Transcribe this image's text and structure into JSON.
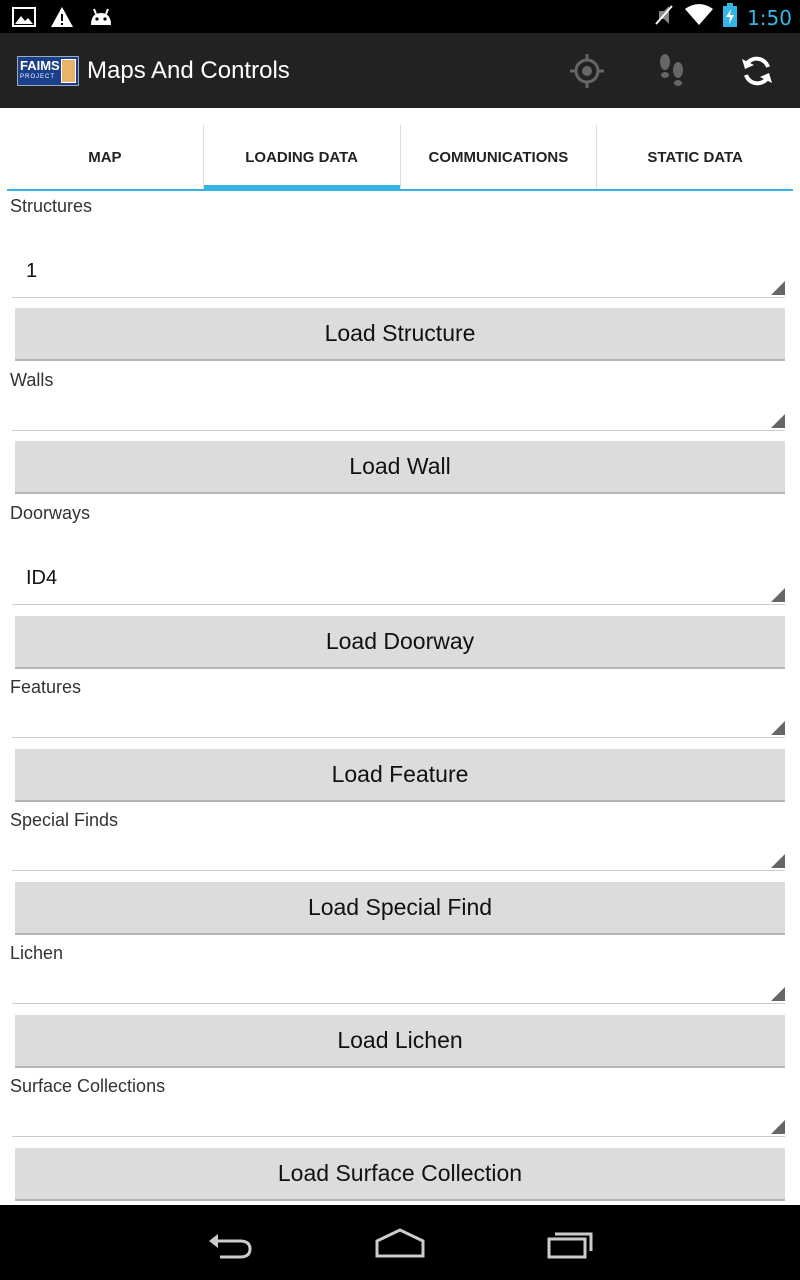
{
  "status_bar": {
    "time": "1:50",
    "left_icons": [
      "gallery-icon",
      "warning-icon",
      "android-icon"
    ],
    "right_icons": [
      "mute-icon",
      "wifi-icon",
      "battery-charging-icon"
    ]
  },
  "action_bar": {
    "logo_text": "FAIMS",
    "logo_sub": "PROJECT",
    "title": "Maps And Controls",
    "actions": [
      "gps-target-icon",
      "footprints-icon",
      "sync-icon"
    ]
  },
  "tabs": [
    {
      "label": "MAP",
      "selected": false
    },
    {
      "label": "LOADING DATA",
      "selected": true
    },
    {
      "label": "COMMUNICATIONS",
      "selected": false
    },
    {
      "label": "STATIC DATA",
      "selected": false
    }
  ],
  "sections": [
    {
      "label": "Structures",
      "value": "1",
      "button": "Load Structure"
    },
    {
      "label": "Walls",
      "value": "",
      "button": "Load Wall"
    },
    {
      "label": "Doorways",
      "value": "ID4",
      "button": "Load Doorway"
    },
    {
      "label": "Features",
      "value": "",
      "button": "Load Feature"
    },
    {
      "label": "Special Finds",
      "value": "",
      "button": "Load Special Find"
    },
    {
      "label": "Lichen",
      "value": "",
      "button": "Load Lichen"
    },
    {
      "label": "Surface Collections",
      "value": "",
      "button": "Load Surface Collection"
    }
  ],
  "nav_bar": [
    "back-icon",
    "home-icon",
    "recent-apps-icon"
  ],
  "colors": {
    "accent": "#33b5e5",
    "action_bar": "#222222",
    "button": "#dcdcdc"
  }
}
